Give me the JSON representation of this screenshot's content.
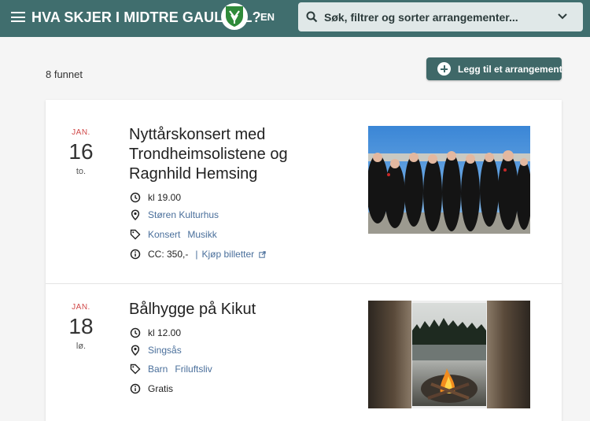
{
  "header": {
    "title": "HVA SKJER I MIDTRE GAULDAL?",
    "lang": "EN",
    "search_placeholder": "Søk, filtrer og sorter arrangementer...",
    "icons": [
      "menu-icon",
      "municipality-logo",
      "search-icon",
      "chevron-down-icon"
    ]
  },
  "toolbar": {
    "result_count": "8 funnet",
    "add_label": "Legg til et arrangement"
  },
  "events": [
    {
      "month": "JAN.",
      "day": "16",
      "weekday": "to.",
      "title": "Nyttårskonsert med Trondheimsolistene og Ragnhild Hemsing",
      "time": "kl 19.00",
      "location": "Støren Kulturhus",
      "tags": [
        "Konsert",
        "Musikk"
      ],
      "price": "CC: 350,-",
      "ticket_link": "Kjøp billetter"
    },
    {
      "month": "JAN.",
      "day": "18",
      "weekday": "lø.",
      "title": "Bålhygge på Kikut",
      "time": "kl 12.00",
      "location": "Singsås",
      "tags": [
        "Barn",
        "Friluftsliv"
      ],
      "price": "Gratis"
    }
  ],
  "colors": {
    "header_bg": "#406e6e",
    "button_bg": "#3f6868",
    "month_red": "#d04848",
    "link_blue": "#4a6f9b"
  }
}
